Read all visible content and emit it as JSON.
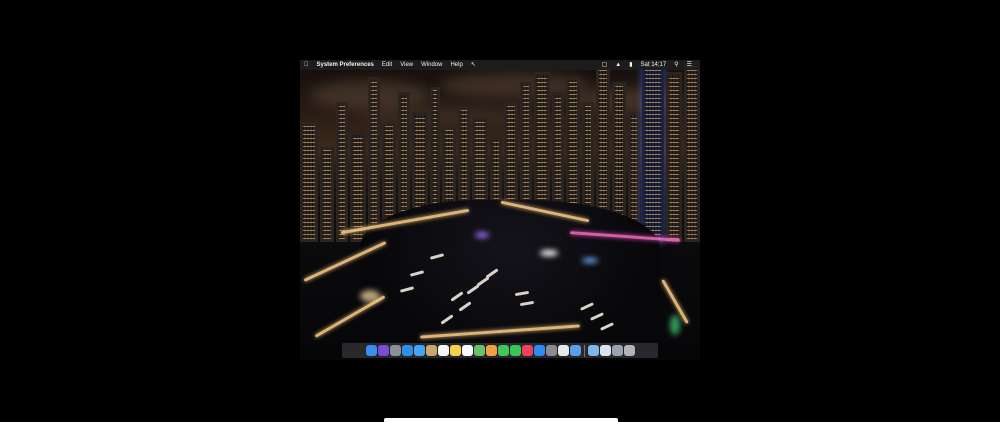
{
  "menubar": {
    "apple_icon": "apple-icon",
    "app_name": "System Preferences",
    "menus": [
      "Edit",
      "View",
      "Window",
      "Help"
    ],
    "status": {
      "clock": "Sat 14:17"
    }
  },
  "dock": {
    "apps": [
      {
        "name": "finder-icon",
        "color": "#3c8df0"
      },
      {
        "name": "siri-icon",
        "color": "#7b4bd8"
      },
      {
        "name": "launchpad-icon",
        "color": "#8a8f99"
      },
      {
        "name": "safari-icon",
        "color": "#2f8fe8"
      },
      {
        "name": "mail-icon",
        "color": "#4aa3f0"
      },
      {
        "name": "contacts-icon",
        "color": "#c9a66b"
      },
      {
        "name": "calendar-icon",
        "color": "#f5f5f5"
      },
      {
        "name": "notes-icon",
        "color": "#f6d24a"
      },
      {
        "name": "reminders-icon",
        "color": "#fafafa"
      },
      {
        "name": "maps-icon",
        "color": "#6cc06a"
      },
      {
        "name": "photos-icon",
        "color": "#f0a040"
      },
      {
        "name": "messages-icon",
        "color": "#42c75a"
      },
      {
        "name": "facetime-icon",
        "color": "#3ac45a"
      },
      {
        "name": "music-icon",
        "color": "#f04060"
      },
      {
        "name": "app-store-icon",
        "color": "#2d8cf0"
      },
      {
        "name": "system-preferences-icon",
        "color": "#8a8a8f"
      },
      {
        "name": "document-icon",
        "color": "#e8e8e8"
      },
      {
        "name": "xcode-icon",
        "color": "#5aa0e8"
      }
    ],
    "right": [
      {
        "name": "downloads-folder-icon",
        "color": "#7fb8e8"
      },
      {
        "name": "preview-icon",
        "color": "#d8e4f0"
      },
      {
        "name": "screen-icon",
        "color": "#9aa4b0"
      },
      {
        "name": "trash-icon",
        "color": "#b0b4b8"
      }
    ]
  }
}
